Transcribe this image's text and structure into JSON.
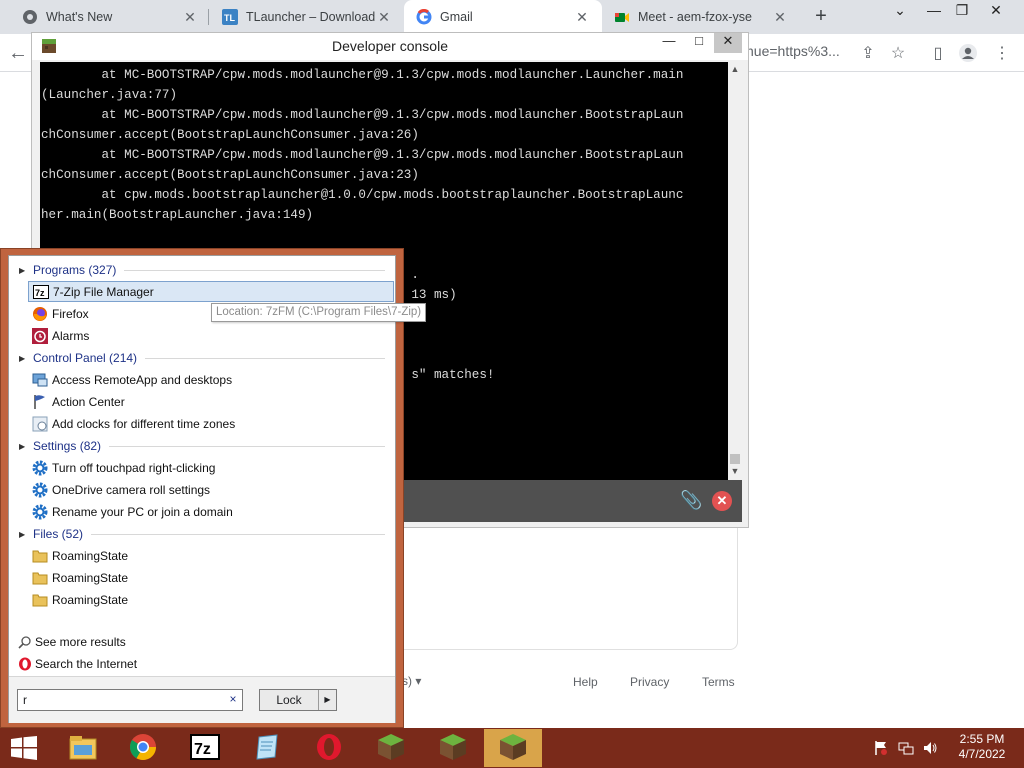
{
  "browser": {
    "tabs": [
      {
        "title": "What's New",
        "icon": "chrome-icon"
      },
      {
        "title": "TLauncher – Download M",
        "icon": "tlauncher-icon"
      },
      {
        "title": "Gmail",
        "icon": "google-icon",
        "active": true
      },
      {
        "title": "Meet - aem-fzox-yse",
        "icon": "google-meet-icon"
      }
    ],
    "new_tab": "+",
    "url_tail": "nue=https%3..."
  },
  "gmail_footer": {
    "lang_suffix": "s)",
    "links": [
      "Help",
      "Privacy",
      "Terms"
    ]
  },
  "dev_console": {
    "title": "Developer console",
    "lines": [
      "        at MC-BOOTSTRAP/cpw.mods.modlauncher@9.1.3/cpw.mods.modlauncher.Launcher.main",
      "(Launcher.java:77)",
      "        at MC-BOOTSTRAP/cpw.mods.modlauncher@9.1.3/cpw.mods.modlauncher.BootstrapLaun",
      "chConsumer.accept(BootstrapLaunchConsumer.java:26)",
      "        at MC-BOOTSTRAP/cpw.mods.modlauncher@9.1.3/cpw.mods.modlauncher.BootstrapLaun",
      "chConsumer.accept(BootstrapLaunchConsumer.java:23)",
      "        at cpw.mods.bootstraplauncher@1.0.0/cpw.mods.bootstraplauncher.BootstrapLaunc",
      "her.main(BootstrapLauncher.java:149)",
      "",
      "",
      "                                                 .",
      "                                                 13 ms)",
      "",
      "",
      "",
      "                                                 s\" matches!"
    ]
  },
  "start_search": {
    "sections": [
      {
        "label": "Programs (327)",
        "items": [
          "7-Zip File Manager",
          "Firefox",
          "Alarms"
        ]
      },
      {
        "label": "Control Panel (214)",
        "items": [
          "Access RemoteApp and desktops",
          "Action Center",
          "Add clocks for different time zones"
        ]
      },
      {
        "label": "Settings (82)",
        "items": [
          "Turn off touchpad right-clicking",
          "OneDrive camera roll settings",
          "Rename your PC or join a domain"
        ]
      },
      {
        "label": "Files (52)",
        "items": [
          "RoamingState",
          "RoamingState",
          "RoamingState"
        ]
      }
    ],
    "see_more": "See more results",
    "search_internet": "Search the Internet",
    "query": "r",
    "clear": "×",
    "lock_label": "Lock",
    "tooltip": "Location: 7zFM (C:\\Program Files\\7-Zip)"
  },
  "taskbar": {
    "apps": [
      "file-explorer",
      "chrome",
      "7-zip",
      "notepad",
      "opera",
      "minecraft",
      "minecraft",
      "minecraft"
    ],
    "time": "2:55 PM",
    "date": "4/7/2022"
  }
}
